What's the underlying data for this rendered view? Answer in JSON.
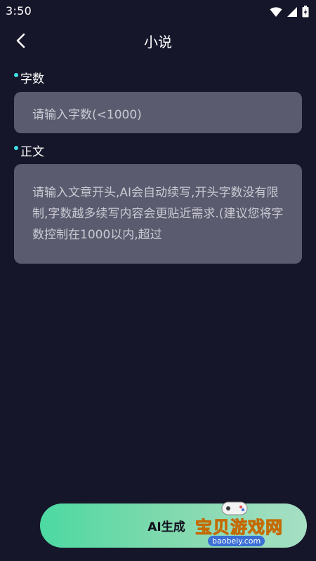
{
  "status_bar": {
    "time": "3:50",
    "icons": [
      "wifi-icon",
      "signal-icon",
      "battery-icon"
    ]
  },
  "header": {
    "title": "小说",
    "back_icon": "chevron-left-icon"
  },
  "word_count": {
    "label": "字数",
    "placeholder": "请输入字数(<1000)"
  },
  "body_text": {
    "label": "正文",
    "placeholder": "请输入文章开头,AI会自动续写,开头字数没有限制,字数越多续写内容会更贴近需求.(建议您将字数控制在1000以内,超过"
  },
  "generate_button": {
    "label": "AI生成"
  },
  "watermark": {
    "text": "宝贝游戏网",
    "url": "baobeiy.com"
  },
  "colors": {
    "background": "#16162a",
    "input_bg": "#5a5b6e",
    "accent_dot": "#3fe0e8",
    "button_gradient_start": "#4cd9a2",
    "button_gradient_end": "#a6dfc4"
  }
}
